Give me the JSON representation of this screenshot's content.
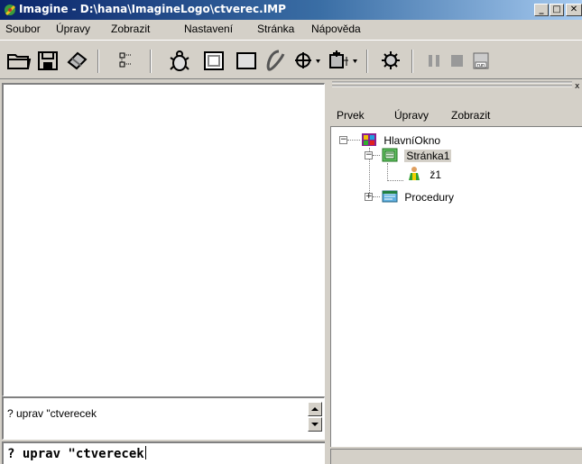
{
  "window": {
    "title": "Imagine - D:\\hana\\ImagineLogo\\ctverec.IMP"
  },
  "menu": {
    "items": [
      "Soubor",
      "Úpravy",
      "Zobrazit",
      "Nastavení",
      "Stránka",
      "Nápověda"
    ]
  },
  "toolbar": {
    "icons": [
      "open-folder-icon",
      "save-disk-icon",
      "erase-icon",
      "tree-view-icon",
      "turtle-icon",
      "window-icon",
      "panel-icon",
      "ellipse-tool-icon",
      "navigation-icon",
      "add-object-icon",
      "settings-icon",
      "pause-icon",
      "stop-icon",
      "run-icon"
    ],
    "run_label": "run"
  },
  "console": {
    "history": "? uprav \"ctverecek",
    "command": "? uprav \"ctverecek"
  },
  "right_panel": {
    "menu": [
      "Prvek",
      "Úpravy",
      "Zobrazit"
    ],
    "tree": [
      {
        "label": "HlavníOkno",
        "icon": "main-window-icon",
        "expanded": true
      },
      {
        "label": "Stránka1",
        "icon": "page-icon",
        "expanded": true,
        "selected": true
      },
      {
        "label": "ž1",
        "icon": "turtle-figure-icon"
      },
      {
        "label": "Procedury",
        "icon": "procedures-icon",
        "expanded": false
      }
    ],
    "colors": {
      "selected_bg": "#d4d0c8"
    }
  },
  "colors": {
    "titlebar_start": "#0a246a",
    "titlebar_end": "#a6caf0",
    "face": "#d4d0c8"
  }
}
